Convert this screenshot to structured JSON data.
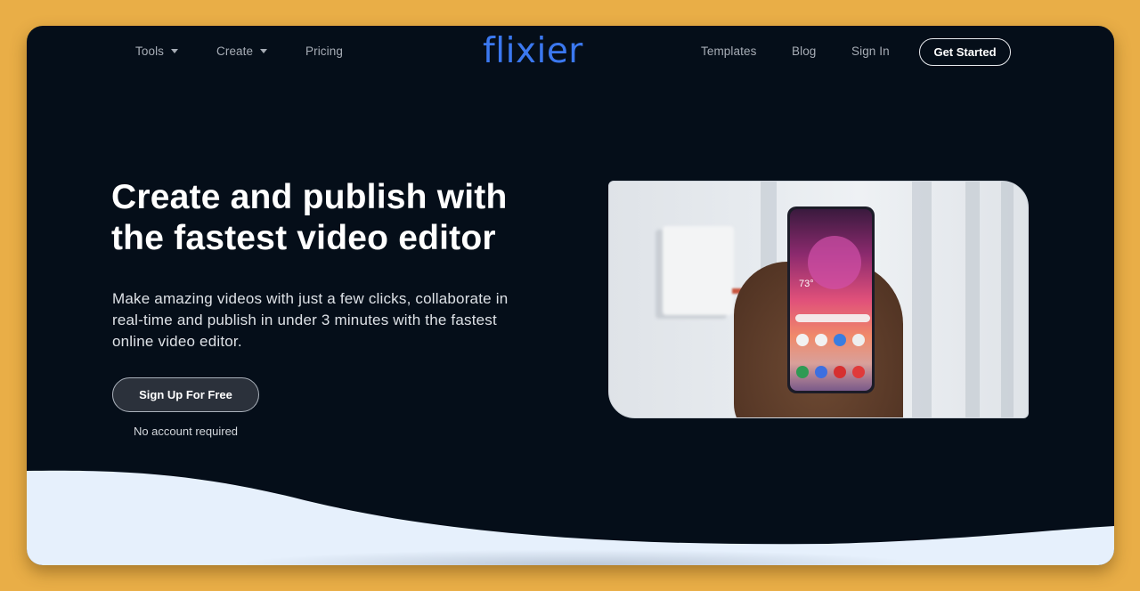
{
  "nav": {
    "left_links": [
      {
        "label": "Tools",
        "has_dropdown": true
      },
      {
        "label": "Create",
        "has_dropdown": true
      },
      {
        "label": "Pricing",
        "has_dropdown": false
      }
    ],
    "logo": "flixier",
    "right_links": [
      {
        "label": "Templates"
      },
      {
        "label": "Blog"
      },
      {
        "label": "Sign In"
      }
    ],
    "cta_label": "Get Started"
  },
  "hero": {
    "headline_line1": "Create and publish with",
    "headline_line2": "the fastest video editor",
    "subtext": "Make amazing videos with just a few clicks, collaborate in real-time and publish in under 3 minutes with the fastest online video editor.",
    "signup_label": "Sign Up For Free",
    "note": "No account required",
    "media": {
      "description": "Hand holding a smartphone showing home screen",
      "phone_temperature": "73°"
    }
  },
  "colors": {
    "background": "#e9ae47",
    "page_dark": "#050e19",
    "brand_blue": "#3b78f0",
    "wave_light": "#e6f0fc"
  }
}
